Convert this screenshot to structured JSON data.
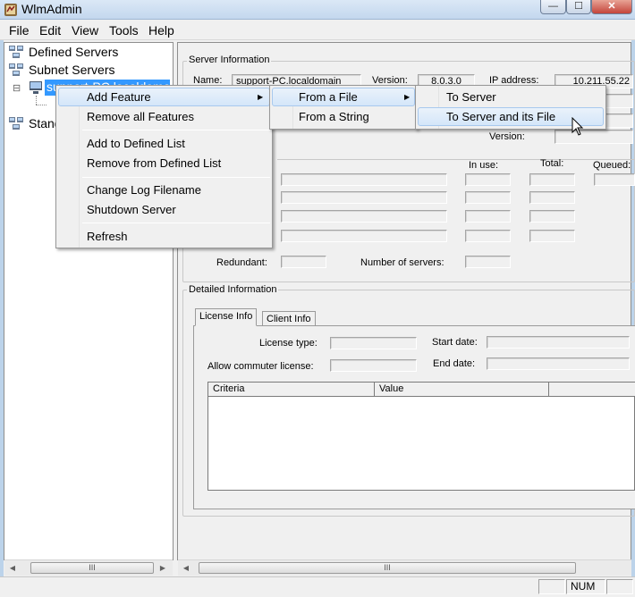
{
  "window": {
    "title": "WlmAdmin",
    "min_glyph": "—",
    "max_glyph": "☐",
    "close_glyph": "✕"
  },
  "menubar": {
    "items": [
      "File",
      "Edit",
      "View",
      "Tools",
      "Help"
    ]
  },
  "tree": {
    "items": [
      "Defined Servers",
      "Subnet Servers",
      "support-PC.localdomain",
      "Standalone"
    ],
    "expander": "⊟"
  },
  "server_info": {
    "group_title": "Server Information",
    "name_label": "Name:",
    "name_value": "support-PC.localdomain",
    "version_label": "Version:",
    "version_value": "8.0.3.0",
    "ip_label": "IP address:",
    "ip_value": "10.211.55.22",
    "version2_label": "Version:"
  },
  "license_stats": {
    "in_use_label": "In use:",
    "total_label": "Total:",
    "queued_label": "Queued:",
    "redundant_label": "Redundant:",
    "num_servers_label": "Number of servers:"
  },
  "detailed_info": {
    "group_title": "Detailed Information",
    "tabs": [
      "License Info",
      "Client Info"
    ],
    "license_type_label": "License type:",
    "start_date_label": "Start date:",
    "commuter_label": "Allow commuter license:",
    "end_date_label": "End date:",
    "columns": [
      "Criteria",
      "Value"
    ]
  },
  "context_menu": {
    "items": [
      "Add Feature",
      "Remove all Features",
      "Add to Defined List",
      "Remove from Defined List",
      "Change Log Filename",
      "Shutdown Server",
      "Refresh"
    ]
  },
  "submenu_add_feature": {
    "items": [
      "From a File",
      "From a String"
    ]
  },
  "submenu_from_file": {
    "items": [
      "To Server",
      "To Server and its File"
    ]
  },
  "scrollbar": {
    "grip": "III",
    "left_arrow": "◀",
    "right_arrow": "▶"
  },
  "statusbar": {
    "num": "NUM"
  },
  "colors": {
    "highlight": "#d4e6f9",
    "selection": "#3399ff",
    "window_bg": "#f0f0f0"
  }
}
